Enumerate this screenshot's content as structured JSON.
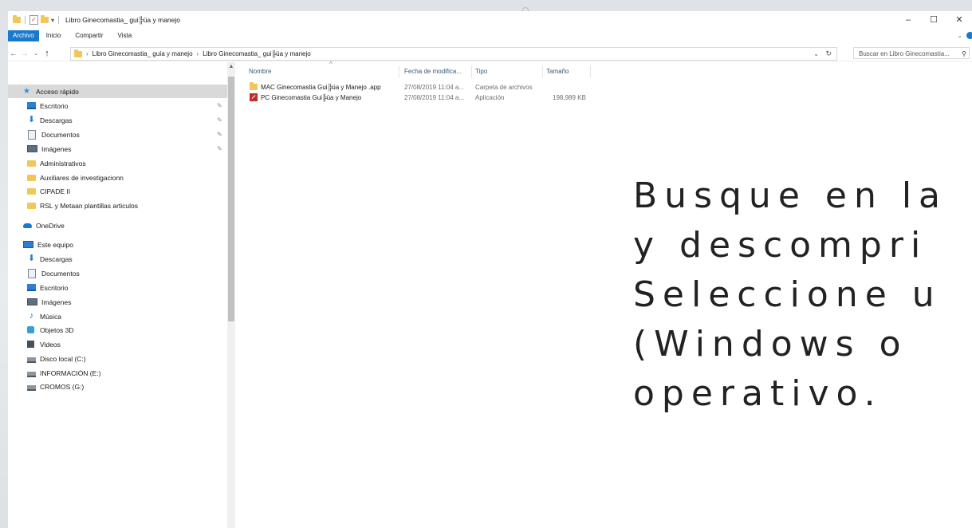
{
  "window": {
    "title": "Libro Ginecomastia_ gui╠üa y manejo",
    "controls": [
      "–",
      "☐",
      "✕"
    ]
  },
  "ribbon": {
    "tabs": [
      "Archivo",
      "Inicio",
      "Compartir",
      "Vista"
    ]
  },
  "address": {
    "crumbs": [
      "Libro Ginecomastia_ guía y manejo",
      "Libro Ginecomastia_ gui╠üa y manejo"
    ],
    "search_placeholder": "Buscar en Libro Ginecomastia..."
  },
  "nav": {
    "quick_access_label": "Acceso rápido",
    "quick_items": [
      "Escritorio",
      "Descargas",
      "Documentos",
      "Imágenes",
      "Administrativos",
      "Auxiliares de investigacionn",
      "CIPADE II",
      "RSL y Metaan plantillas articulos"
    ],
    "onedrive_label": "OneDrive",
    "this_pc_label": "Este equipo",
    "pc_items": [
      "Descargas",
      "Documentos",
      "Escritorio",
      "Imágenes",
      "Música",
      "Objetos 3D",
      "Videos",
      "Disco local (C:)",
      "INFORMACIÓN (E:)",
      "CROMOS (G:)"
    ]
  },
  "files": {
    "headers": [
      "Nombre",
      "Fecha de modifica...",
      "Tipo",
      "Tamaño"
    ],
    "rows": [
      {
        "name": "MAC Ginecomastia Gui╠üa y Manejo .app",
        "date": "27/08/2019 11:04 a...",
        "type": "Carpeta de archivos",
        "size": "",
        "icon": "folder-icon"
      },
      {
        "name": "PC Ginecomastia Gui╠üa y Manejo",
        "date": "27/08/2019 11:04 a...",
        "type": "Aplicación",
        "size": "198,989 KB",
        "icon": "application-icon"
      }
    ]
  },
  "overlay": {
    "lines": [
      "Busque en la",
      "y descompri",
      "Seleccione u",
      "(Windows o",
      "operativo."
    ]
  },
  "colors": {
    "accent": "#1979ca",
    "folder": "#f1c75a",
    "selection": "#d9d9d9"
  }
}
